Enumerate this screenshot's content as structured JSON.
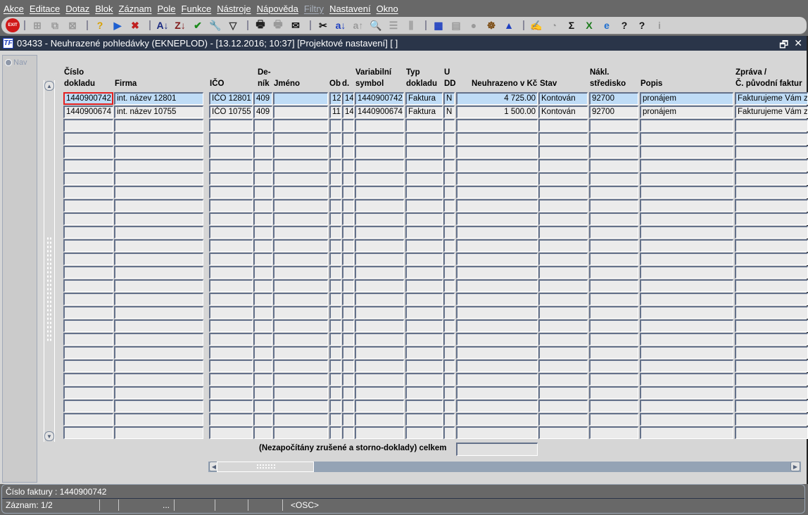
{
  "menu": [
    {
      "label": "Akce"
    },
    {
      "label": "Editace"
    },
    {
      "label": "Dotaz"
    },
    {
      "label": "Blok"
    },
    {
      "label": "Záznam"
    },
    {
      "label": "Pole"
    },
    {
      "label": "Funkce"
    },
    {
      "label": "Nástroje"
    },
    {
      "label": "Nápověda"
    },
    {
      "label": "Filtry",
      "disabled": true
    },
    {
      "label": "Nastavení"
    },
    {
      "label": "Okno"
    }
  ],
  "toolbar": {
    "exit_label": "EXIT",
    "icons": [
      {
        "name": "sep"
      },
      {
        "name": "insert-record-icon",
        "glyph": "⊞",
        "disabled": true
      },
      {
        "name": "duplicate-record-icon",
        "glyph": "⧉",
        "disabled": true
      },
      {
        "name": "delete-record-icon",
        "glyph": "⊠",
        "disabled": true
      },
      {
        "name": "sep"
      },
      {
        "name": "query-enter-icon",
        "glyph": "?",
        "color": "#d8a000"
      },
      {
        "name": "query-execute-icon",
        "glyph": "▶",
        "color": "#1e5fd0"
      },
      {
        "name": "query-cancel-icon",
        "glyph": "✖",
        "color": "#c02020"
      },
      {
        "name": "sep"
      },
      {
        "name": "sort-ascending-icon",
        "glyph": "A↓",
        "color": "#1a2a80"
      },
      {
        "name": "sort-descending-icon",
        "glyph": "Z↓",
        "color": "#801a1a"
      },
      {
        "name": "check-icon",
        "glyph": "✔",
        "color": "#1a8a1a"
      },
      {
        "name": "wrench-icon",
        "glyph": "🔧",
        "color": "#d01010"
      },
      {
        "name": "filter-icon",
        "glyph": "▽",
        "color": "#333"
      },
      {
        "name": "sep"
      },
      {
        "name": "print-icon",
        "glyph": "🖶",
        "color": "#222"
      },
      {
        "name": "print-setup-icon",
        "glyph": "🖶",
        "disabled": true
      },
      {
        "name": "mail-icon",
        "glyph": "✉",
        "color": "#111"
      },
      {
        "name": "sep"
      },
      {
        "name": "cut-icon",
        "glyph": "✂",
        "color": "#111"
      },
      {
        "name": "copy-field-icon",
        "glyph": "a↓",
        "color": "#1e3fc0"
      },
      {
        "name": "paste-field-icon",
        "glyph": "a↑",
        "disabled": true
      },
      {
        "name": "zoom-icon",
        "glyph": "🔍",
        "color": "#1e5fd0"
      },
      {
        "name": "list-icon",
        "glyph": "☰",
        "disabled": true
      },
      {
        "name": "columns-icon",
        "glyph": "⫼",
        "disabled": true
      },
      {
        "name": "sep"
      },
      {
        "name": "export-icon",
        "glyph": "▦",
        "color": "#1e3fc0"
      },
      {
        "name": "document-icon",
        "glyph": "▤",
        "disabled": true
      },
      {
        "name": "globe-icon",
        "glyph": "●",
        "disabled": true
      },
      {
        "name": "helm-icon",
        "glyph": "☸",
        "color": "#7a4a10"
      },
      {
        "name": "eye-icon",
        "glyph": "▲",
        "color": "#1e3fc0"
      },
      {
        "name": "sep"
      },
      {
        "name": "signature-icon",
        "glyph": "✍",
        "color": "#111"
      },
      {
        "name": "clock-icon",
        "glyph": "◔",
        "disabled": true
      },
      {
        "name": "sum-icon",
        "glyph": "Σ",
        "color": "#111"
      },
      {
        "name": "excel-icon",
        "glyph": "X",
        "color": "#1a7a1a"
      },
      {
        "name": "browser-icon",
        "glyph": "e",
        "color": "#1e6fd0"
      },
      {
        "name": "help-icon",
        "glyph": "?",
        "color": "#111"
      },
      {
        "name": "help-window-icon",
        "glyph": "?",
        "color": "#111"
      },
      {
        "name": "info-icon",
        "glyph": "i",
        "disabled": true
      }
    ]
  },
  "window": {
    "title": "03433 - Neuhrazené pohledávky (EKNEPLOD) - [13.12.2016; 10:37]  [Projektové nastavení]  [ ]",
    "logo": "TF",
    "restore": "🗗",
    "close": "✕"
  },
  "nav_label": "Nav",
  "grid": {
    "headers": {
      "cislo": "Číslo\ndokladu",
      "firma": "Firma",
      "ico": "IČO",
      "denik": "De-\nník",
      "jmeno": "Jméno",
      "ob": "Ob",
      "d": "d.",
      "varsym": "Variabilní\nsymbol",
      "typ": "Typ\ndokladu",
      "udd": "U\nDD",
      "neuhrazeno": "Neuhrazeno v Kč",
      "stav": "Stav",
      "nakl": "Nákl.\nstředisko",
      "popis": "Popis",
      "zprava": "Zpráva /\nČ. původní faktur"
    },
    "rows": [
      {
        "cislo": "1440900742",
        "firma": "int. název 12801",
        "ico": "IČO 12801",
        "denik": "409",
        "jmeno": "",
        "ob": "12",
        "d": "14",
        "varsym": "1440900742",
        "typ": "Faktura",
        "udd": "N",
        "neuhrazeno": "4 725.00",
        "stav": "Kontován",
        "nakl": "92700",
        "popis": "pronájem",
        "zprava": "Fakturujeme Vám z"
      },
      {
        "cislo": "1440900674",
        "firma": "int. název 10755",
        "ico": "IČO 10755",
        "denik": "409",
        "jmeno": "",
        "ob": "11",
        "d": "14",
        "varsym": "1440900674",
        "typ": "Faktura",
        "udd": "N",
        "neuhrazeno": "1 500.00",
        "stav": "Kontován",
        "nakl": "92700",
        "popis": "pronájem",
        "zprava": "Fakturujeme Vám z"
      }
    ],
    "total_label": "(Nezapočítány zrušené a storno-doklady) celkem",
    "total_value": ""
  },
  "status": {
    "line1": "Číslo faktury : 1440900742",
    "record": "Záznam: 1/2",
    "ellipsis": "...",
    "mode": "<OSC>"
  }
}
